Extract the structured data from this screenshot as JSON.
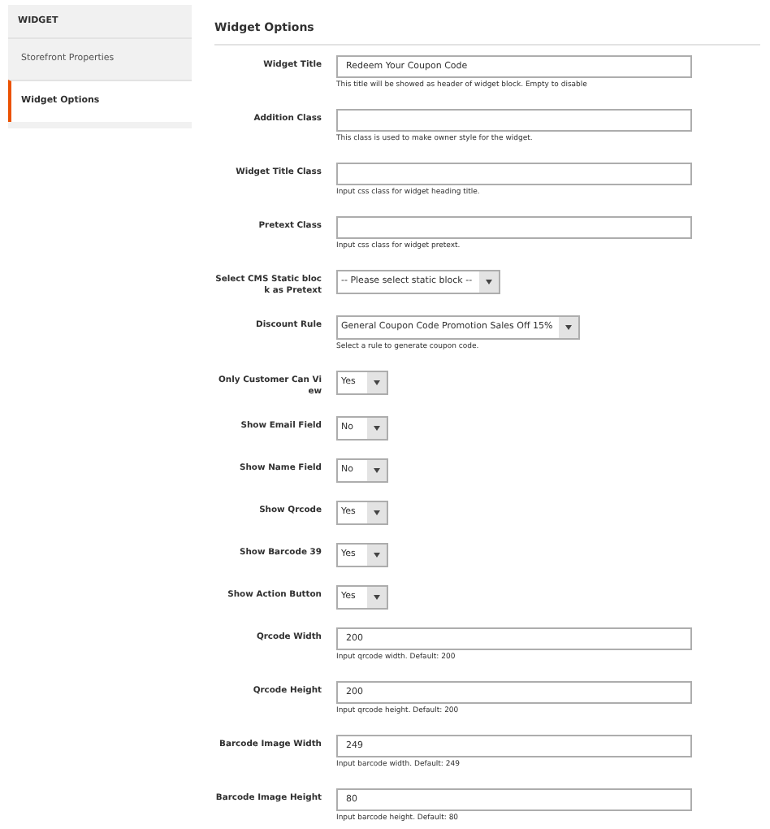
{
  "sidebar": {
    "heading": "WIDGET",
    "items": [
      {
        "label": "Storefront Properties",
        "selected": false
      },
      {
        "label": "Widget Options",
        "selected": true
      }
    ]
  },
  "section_title": "Widget Options",
  "fields": [
    {
      "kind": "text",
      "label": "Widget Title",
      "value": "Redeem Your Coupon Code",
      "hint": "This title will be showed as header of widget block. Empty to disable"
    },
    {
      "kind": "text",
      "label": "Addition Class",
      "hint": "This class is used to make owner style for the widget."
    },
    {
      "kind": "text",
      "label": "Widget Title Class",
      "hint": "Input css class for widget heading title."
    },
    {
      "kind": "text",
      "label": "Pretext Class",
      "hint": "Input css class for widget pretext."
    },
    {
      "kind": "select",
      "label": "Select CMS Static block as Pretext",
      "value": "-- Please select static block --"
    },
    {
      "kind": "select",
      "label": "Discount Rule",
      "value": "General Coupon Code Promotion Sales Off 15%",
      "hint": "Select a rule to generate coupon code."
    },
    {
      "kind": "select",
      "label": "Only Customer Can View",
      "value": "Yes"
    },
    {
      "kind": "select",
      "label": "Show Email Field",
      "value": "No"
    },
    {
      "kind": "select",
      "label": "Show Name Field",
      "value": "No"
    },
    {
      "kind": "select",
      "label": "Show Qrcode",
      "value": "Yes"
    },
    {
      "kind": "select",
      "label": "Show Barcode 39",
      "value": "Yes"
    },
    {
      "kind": "select",
      "label": "Show Action Button",
      "value": "Yes"
    },
    {
      "kind": "text",
      "label": "Qrcode Width",
      "value": "200",
      "hint": "Input qrcode width. Default: 200"
    },
    {
      "kind": "text",
      "label": "Qrcode Height",
      "value": "200",
      "hint": "Input qrcode height. Default: 200"
    },
    {
      "kind": "text",
      "label": "Barcode Image Width",
      "value": "249",
      "hint": "Input barcode width. Default: 249"
    },
    {
      "kind": "text",
      "label": "Barcode Image Height",
      "value": "80",
      "hint": "Input barcode height. Default: 80"
    }
  ]
}
